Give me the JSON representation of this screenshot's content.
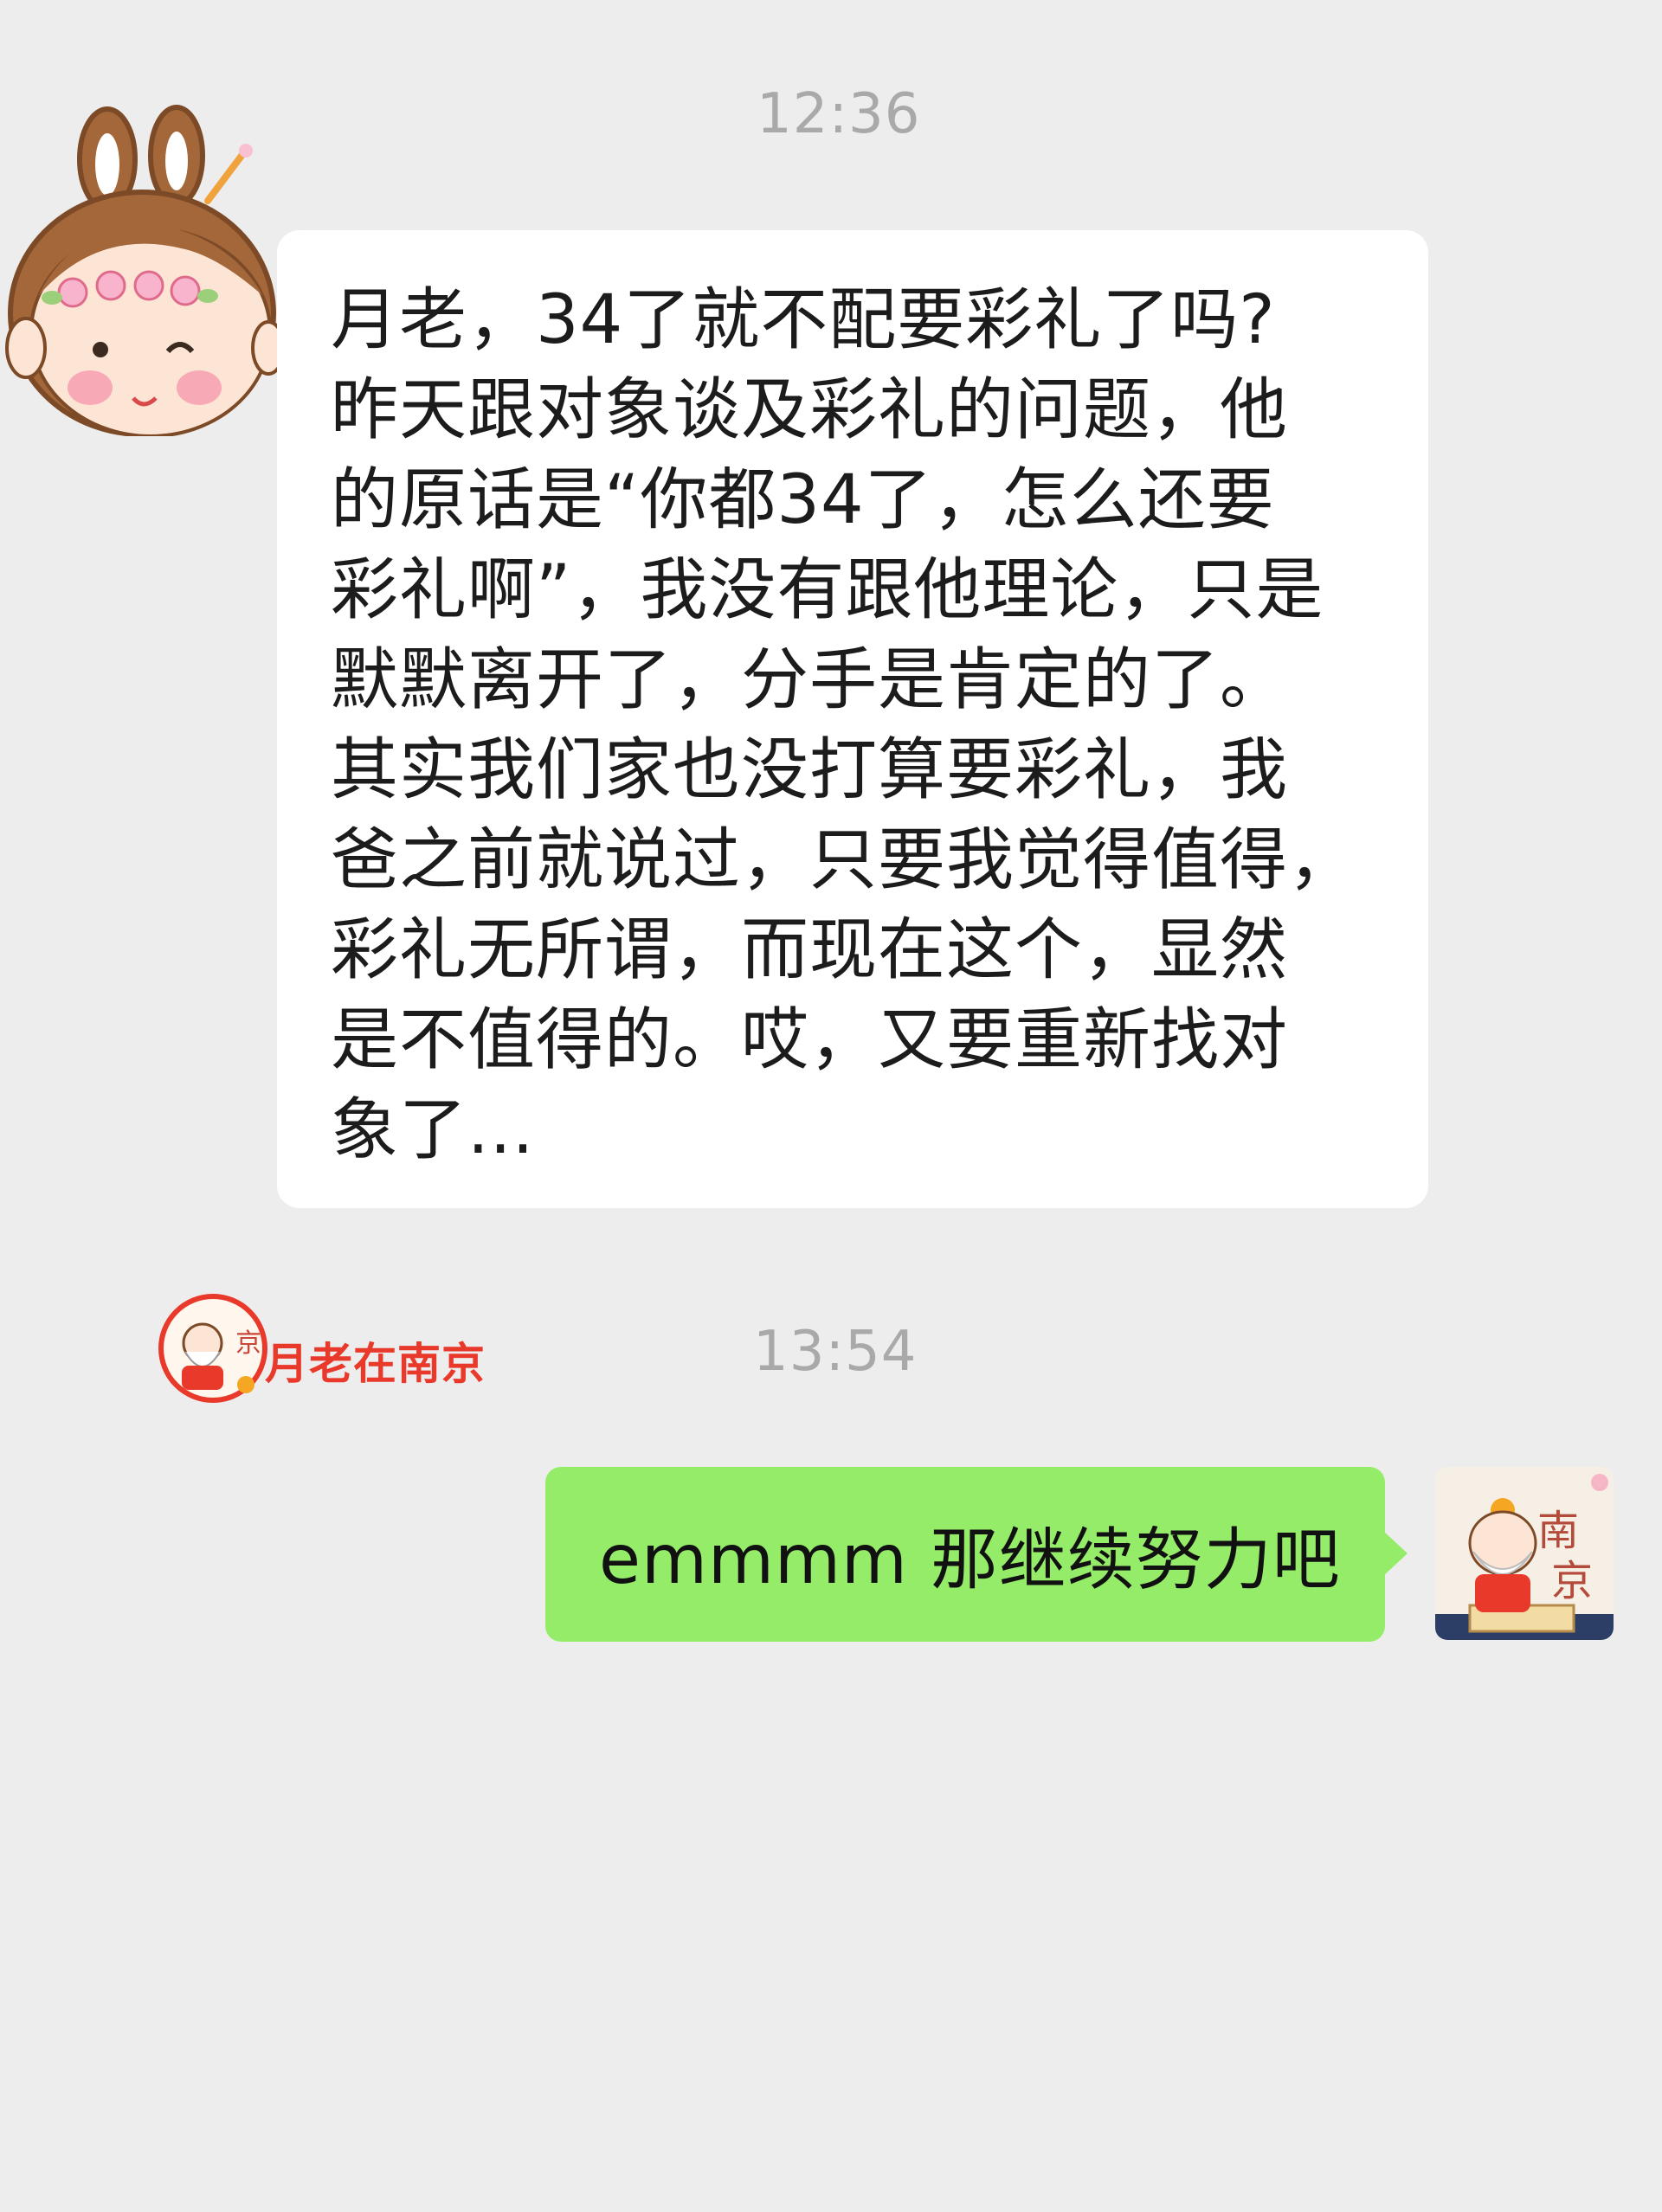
{
  "chat": {
    "timestamps": [
      "12:36",
      "13:54"
    ],
    "incoming": {
      "avatar_icon": "cartoon-girl-avatar",
      "text": "月老，34了就不配要彩礼了吗?\n昨天跟对象谈及彩礼的问题，他\n的原话是“你都34了，怎么还要\n彩礼啊”，我没有跟他理论，只是\n默默离开了，分手是肯定的了。\n其实我们家也没打算要彩礼，我\n爸之前就说过，只要我觉得值得，\n彩礼无所谓，而现在这个，显然\n是不值得的。哎，又要重新找对\n象了..."
    },
    "outgoing": {
      "avatar_icon": "old-man-nanjing-avatar",
      "text": "emmmm 那继续努力吧"
    }
  },
  "watermark": {
    "logo_icon": "yuelao-logo-icon",
    "text": "月老在南京"
  },
  "colors": {
    "background": "#ededed",
    "bubble_in": "#ffffff",
    "bubble_out": "#95ec69",
    "timestamp": "#a9a9a9",
    "watermark_text": "#e8392b"
  }
}
